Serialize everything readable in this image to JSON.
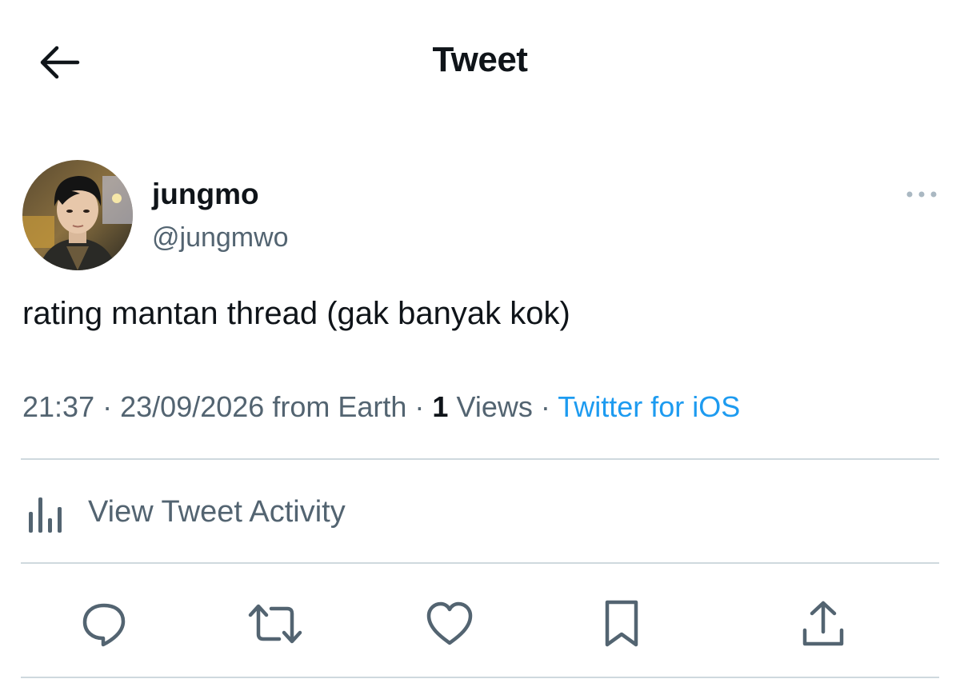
{
  "header": {
    "title": "Tweet",
    "back_icon": "arrow-left-icon"
  },
  "author": {
    "display_name": "jungmo",
    "handle": "@jungmwo",
    "avatar": "profile-photo"
  },
  "tweet": {
    "text": "rating mantan thread (gak banyak kok)",
    "time": "21:37",
    "date": "23/09/2026",
    "location": "from Earth",
    "views_count": "1",
    "views_label": "Views",
    "separator": "·",
    "source": "Twitter for iOS"
  },
  "activity": {
    "label": "View Tweet Activity",
    "icon": "bar-chart-icon"
  },
  "actions": [
    {
      "name": "reply",
      "icon": "reply-icon"
    },
    {
      "name": "retweet",
      "icon": "retweet-icon"
    },
    {
      "name": "like",
      "icon": "heart-icon"
    },
    {
      "name": "bookmark",
      "icon": "bookmark-icon"
    },
    {
      "name": "share",
      "icon": "share-icon"
    }
  ],
  "colors": {
    "text_primary": "#0f1419",
    "text_secondary": "#536471",
    "link": "#1d9bf0",
    "divider": "#cfd9de"
  }
}
